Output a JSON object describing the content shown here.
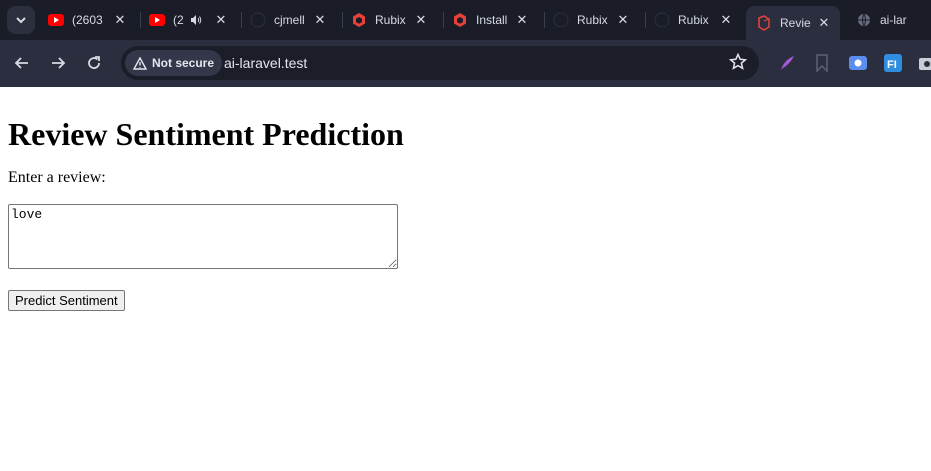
{
  "browser": {
    "tabs": [
      {
        "title": "(2603",
        "icon": "youtube-icon",
        "audio": false
      },
      {
        "title": "(2",
        "icon": "youtube-icon",
        "audio": true
      },
      {
        "title": "cjmell",
        "icon": "github-icon",
        "audio": false
      },
      {
        "title": "Rubix",
        "icon": "laravel-icon",
        "audio": false
      },
      {
        "title": "Install",
        "icon": "laravel-icon",
        "audio": false
      },
      {
        "title": "Rubix",
        "icon": "github-icon",
        "audio": false
      },
      {
        "title": "Rubix",
        "icon": "github-icon",
        "audio": false
      },
      {
        "title": "Revie",
        "icon": "laravel-icon",
        "audio": false,
        "active": true
      },
      {
        "title": "ai-lar",
        "icon": "globe-icon",
        "audio": false
      }
    ],
    "security_label": "Not secure",
    "url": "ai-laravel.test",
    "accent": "#2b2e3e"
  },
  "page": {
    "title": "Review Sentiment Prediction",
    "prompt_label": "Enter a review:",
    "review_value": "love",
    "submit_label": "Predict Sentiment"
  }
}
